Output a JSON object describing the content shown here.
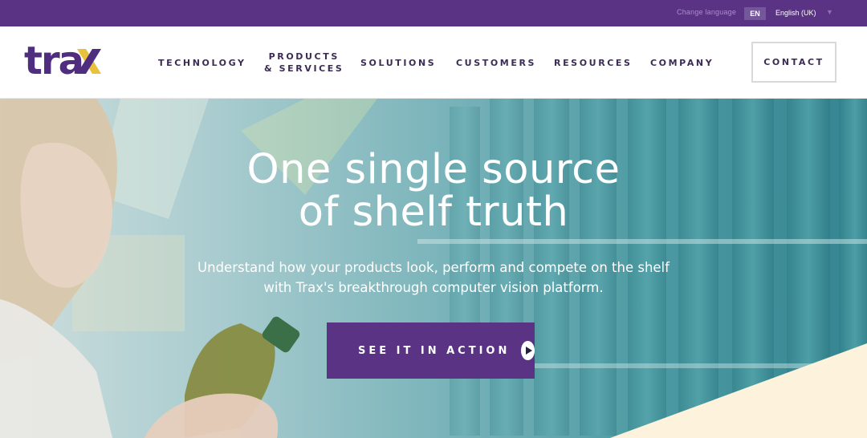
{
  "language_bar": {
    "change_language": "Change language",
    "badge": "EN",
    "selected": "English (UK)"
  },
  "header": {
    "logo_text": "trax",
    "nav": [
      {
        "label": "TECHNOLOGY"
      },
      {
        "line1": "PRODUCTS",
        "line2": "& SERVICES"
      },
      {
        "label": "SOLUTIONS"
      },
      {
        "label": "CUSTOMERS"
      },
      {
        "label": "RESOURCES"
      },
      {
        "label": "COMPANY"
      }
    ],
    "contact_label": "CONTACT"
  },
  "hero": {
    "title_line1": "One single source",
    "title_line2": "of shelf truth",
    "subtitle": "Understand how your products look, perform and compete on the shelf\nwith Trax's breakthrough computer vision platform.",
    "cta_label": "SEE IT IN ACTION"
  },
  "colors": {
    "brand_purple": "#5a3385",
    "logo_yellow": "#e9c23c",
    "hero_teal": "#3d8d97",
    "corner_cream": "#fdf3dd"
  },
  "icons": [
    "chevron-down-icon",
    "play-icon"
  ]
}
